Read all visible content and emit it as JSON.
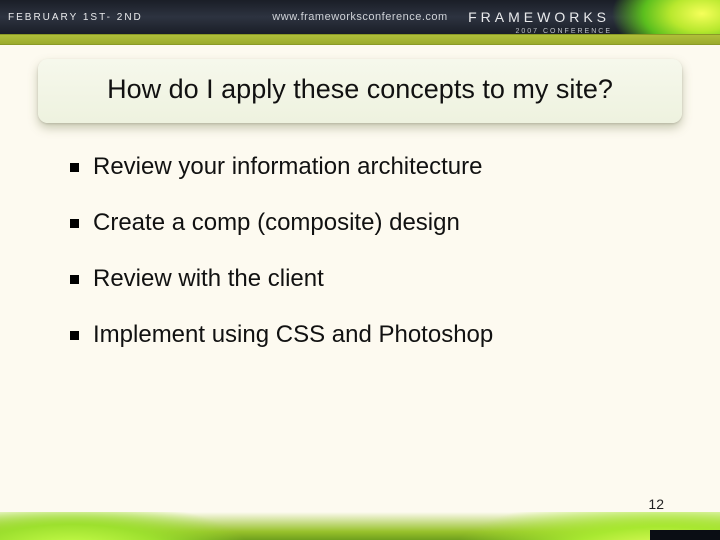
{
  "header": {
    "date": "FEBRUARY 1ST- 2ND",
    "url": "www.frameworksconference.com",
    "logo_main": "FRAMEWORKS",
    "logo_sub": "2007 CONFERENCE"
  },
  "title": "How do I apply these concepts to my site?",
  "bullets": [
    "Review your information architecture",
    "Create a comp (composite) design",
    "Review with the client",
    "Implement using CSS and Photoshop"
  ],
  "page_number": "12"
}
